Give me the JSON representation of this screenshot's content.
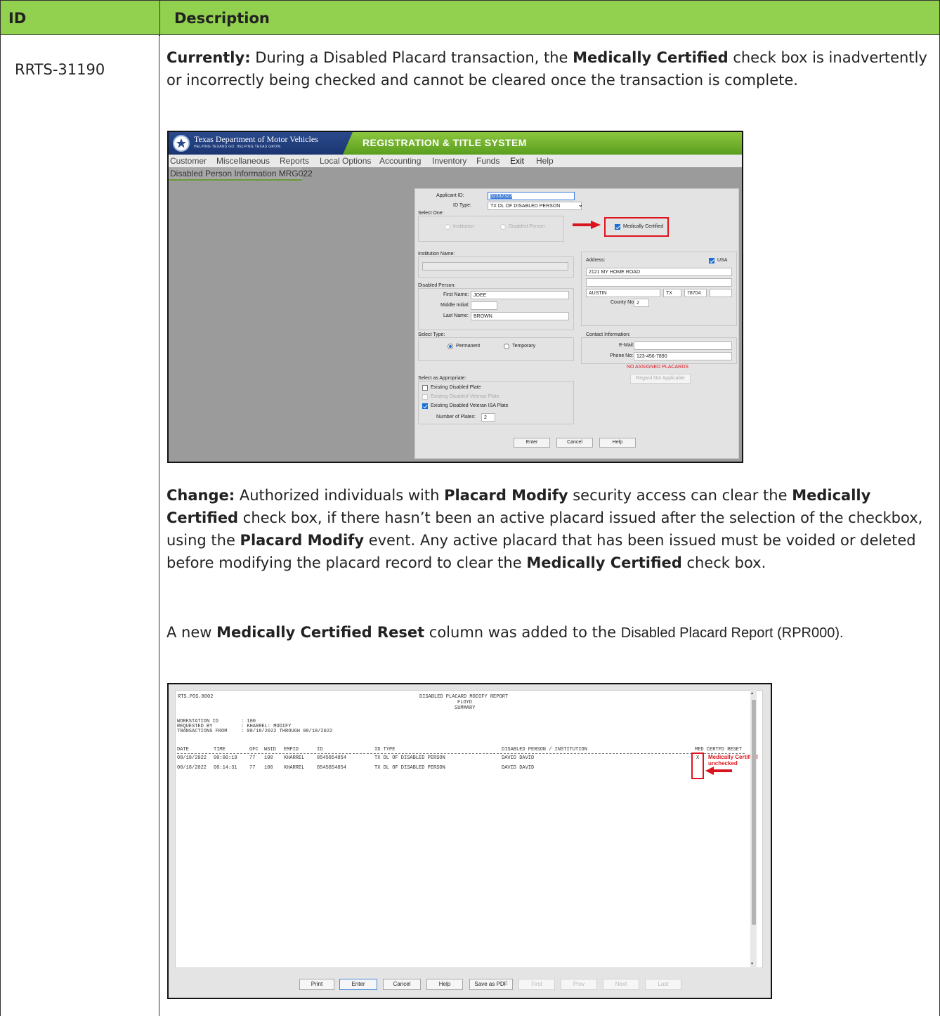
{
  "table": {
    "header": {
      "id": "ID",
      "description": "Description"
    },
    "row": {
      "id": "RRTS-31190",
      "currently_label": "Currently:",
      "currently_text_1": " During a Disabled Placard transaction, the ",
      "currently_bold_1": "Medically Certified",
      "currently_text_2": " check box is inadvertently or incorrectly being checked and cannot be cleared once the transaction is complete.",
      "change_label": "Change:",
      "change_text_1": " Authorized individuals with ",
      "change_bold_1": "Placard Modify",
      "change_text_2": " security access can clear the ",
      "change_bold_2": "Medically Certified",
      "change_text_3": " check box, if there hasn’t been an active placard issued after the selection of the checkbox, using the ",
      "change_bold_3": "Placard Modify",
      "change_text_4": " event. Any active placard that has been issued must be voided or deleted before modifying the placard record to clear the ",
      "change_bold_4": "Medically Certified",
      "change_text_5": " check box.",
      "new_text_1": "A new ",
      "new_bold_1": "Medically Certified Reset",
      "new_text_2": " column was added to the ",
      "new_text_3": "Disabled Placard Report (RPR000)."
    }
  },
  "screenshot1": {
    "agency_name": "Texas Department of Motor Vehicles",
    "agency_tagline": "HELPING TEXANS GO. HELPING TEXAS GROW.",
    "system_name": "REGISTRATION & TITLE SYSTEM",
    "menu": [
      "Customer",
      "Miscellaneous",
      "Reports",
      "Local Options",
      "Accounting",
      "Inventory",
      "Funds",
      "Exit",
      "Help"
    ],
    "screen_title": "Disabled Person Information MRG022",
    "applicant_id_label": "Applicant ID:",
    "applicant_id_value": "32332323",
    "id_type_label": "ID Type:",
    "id_type_value": "TX DL OF DISABLED PERSON",
    "select_one_label": "Select One:",
    "institution_option": "Institution",
    "disabled_person_option": "Disabled Person",
    "medically_certified_label": "Medically Certified",
    "medically_certified_checked": true,
    "institution_name_label": "Institution Name:",
    "address_label": "Address:",
    "usa_label": "USA",
    "address_line1": "2121 MY HOME ROAD",
    "city": "AUSTIN",
    "state": "TX",
    "zip": "78704",
    "county_no_label": "County No:",
    "county_no_value": "2",
    "disabled_person_label": "Disabled Person:",
    "first_name_label": "First Name:",
    "first_name_value": "JOEE",
    "middle_initial_label": "Middle Initial:",
    "middle_initial_value": "",
    "last_name_label": "Last Name:",
    "last_name_value": "BROWN",
    "select_type_label": "Select Type:",
    "permanent_option": "Permanent",
    "temporary_option": "Temporary",
    "contact_info_label": "Contact Information:",
    "email_label": "E-Mail:",
    "email_value": "",
    "phone_label": "Phone No:",
    "phone_value": "123-456-7890",
    "no_placards_text": "NO ASSIGNED PLACARDS",
    "regard_button": "Regard Not Applicable",
    "select_appropriate_label": "Select as Appropriate:",
    "existing_plate_label": "Existing Disabled Plate",
    "existing_veteran_plate_label": "Existing Disabled Veteran Plate",
    "existing_veteran_isa_label": "Existing Disabled Veteran ISA Plate",
    "number_of_plates_label": "Number of Plates:",
    "number_of_plates_value": "2",
    "buttons": [
      "Enter",
      "Cancel",
      "Help"
    ]
  },
  "screenshot2": {
    "report_code": "RTS.POS.8002",
    "report_title": "DISABLED PLACARD MODIFY REPORT",
    "report_sub1": "FLOYD",
    "report_sub2": "SUMMARY",
    "meta": [
      {
        "label": "WORKSTATION ID",
        "value": ": 100"
      },
      {
        "label": "REQUESTED BY",
        "value": ": KHARREL: MODIFY"
      },
      {
        "label": "TRANSACTIONS FROM",
        "value": ": 08/18/2022 THROUGH 08/18/2022"
      }
    ],
    "columns": [
      "DATE",
      "TIME",
      "OFC",
      "WSID",
      "EMPID",
      "ID",
      "ID TYPE",
      "DISABLED PERSON / INSTITUTION",
      "MED CERTFD RESET"
    ],
    "rows": [
      {
        "date": "08/18/2022",
        "time": "00:00:19",
        "ofc": "77",
        "wsid": "100",
        "empid": "KHARREL",
        "id": "8545854854",
        "id_type": "TX DL OF DISABLED PERSON",
        "person": "DAVID DAVID",
        "reset": "X"
      },
      {
        "date": "08/18/2022",
        "time": "00:14:31",
        "ofc": "77",
        "wsid": "100",
        "empid": "KHARREL",
        "id": "8545854854",
        "id_type": "TX DL OF DISABLED PERSON",
        "person": "DAVID DAVID",
        "reset": ""
      }
    ],
    "annotation_line1": "Medically Certified",
    "annotation_line2": "unchecked",
    "buttons": [
      "Print",
      "Enter",
      "Cancel",
      "Help",
      "Save as PDF",
      "First",
      "Prev",
      "Next",
      "Last"
    ]
  }
}
